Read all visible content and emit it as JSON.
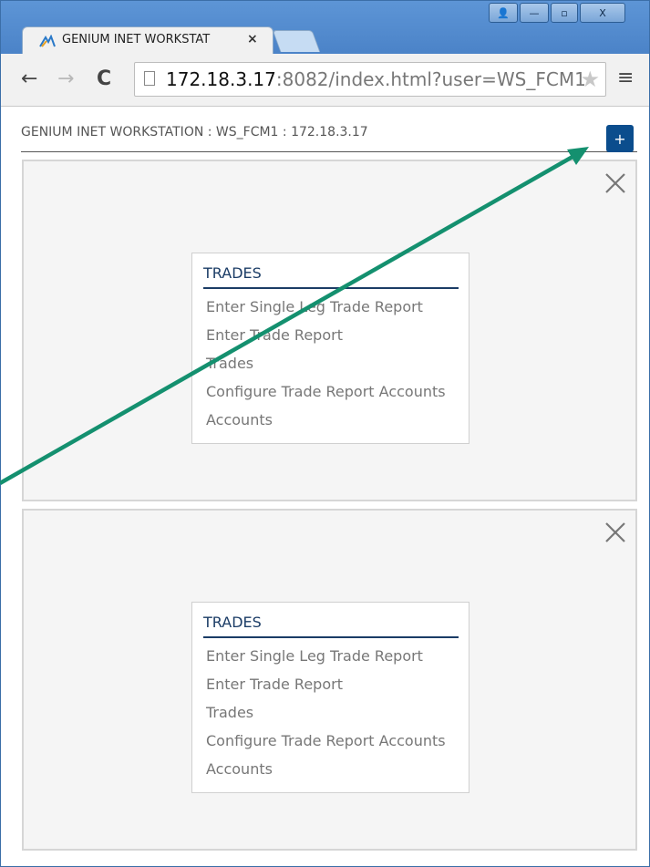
{
  "browser": {
    "tab_title": "GENIUM INET WORKSTAT",
    "tab_close": "×",
    "window_controls": {
      "user": "👤",
      "minimize": "—",
      "maximize": "▫",
      "close": "X"
    },
    "nav": {
      "back": "←",
      "forward": "→",
      "reload": "C"
    },
    "url_host": "172.18.3.17",
    "url_rest": ":8082/index.html?user=WS_FCM1",
    "star": "★",
    "menu": "≡"
  },
  "app": {
    "title": "GENIUM INET WORKSTATION : WS_FCM1 : 172.18.3.17",
    "add_label": "+"
  },
  "panels": [
    {
      "card_title": "TRADES",
      "items": [
        "Enter Single Leg Trade Report",
        "Enter Trade Report",
        "Trades",
        "Configure Trade Report Accounts",
        "Accounts"
      ]
    },
    {
      "card_title": "TRADES",
      "items": [
        "Enter Single Leg Trade Report",
        "Enter Trade Report",
        "Trades",
        "Configure Trade Report Accounts",
        "Accounts"
      ]
    }
  ],
  "colors": {
    "accent": "#0b4d8d",
    "annotation_arrow": "#14906f",
    "card_title": "#1b3c66"
  },
  "icons": {
    "favicon": "favicon-icon",
    "page": "page-icon",
    "panel_close": "close-icon"
  }
}
